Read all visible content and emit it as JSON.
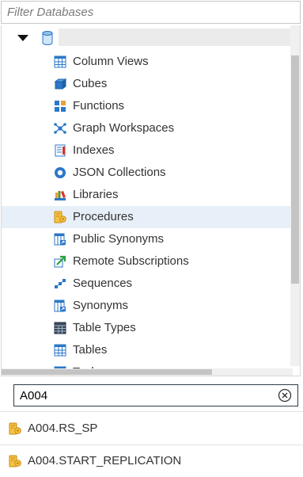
{
  "filter": {
    "placeholder": "Filter Databases"
  },
  "tree": {
    "items": [
      {
        "label": "Column Views",
        "icon": "column-views-icon"
      },
      {
        "label": "Cubes",
        "icon": "cube-icon"
      },
      {
        "label": "Functions",
        "icon": "function-icon"
      },
      {
        "label": "Graph Workspaces",
        "icon": "graph-workspace-icon"
      },
      {
        "label": "Indexes",
        "icon": "index-icon"
      },
      {
        "label": "JSON Collections",
        "icon": "json-collection-icon"
      },
      {
        "label": "Libraries",
        "icon": "library-icon"
      },
      {
        "label": "Procedures",
        "icon": "procedure-icon"
      },
      {
        "label": "Public Synonyms",
        "icon": "public-synonym-icon"
      },
      {
        "label": "Remote Subscriptions",
        "icon": "remote-subscription-icon"
      },
      {
        "label": "Sequences",
        "icon": "sequence-icon"
      },
      {
        "label": "Synonyms",
        "icon": "synonym-icon"
      },
      {
        "label": "Table Types",
        "icon": "table-type-icon"
      },
      {
        "label": "Tables",
        "icon": "table-icon"
      },
      {
        "label": "Tasks",
        "icon": "task-icon"
      }
    ]
  },
  "search": {
    "value": "A004"
  },
  "results": [
    {
      "label": "A004.RS_SP",
      "icon": "procedure-icon"
    },
    {
      "label": "A004.START_REPLICATION",
      "icon": "procedure-icon"
    }
  ],
  "colors": {
    "selection": "#e7eff8",
    "accent_blue": "#2b77c9"
  }
}
